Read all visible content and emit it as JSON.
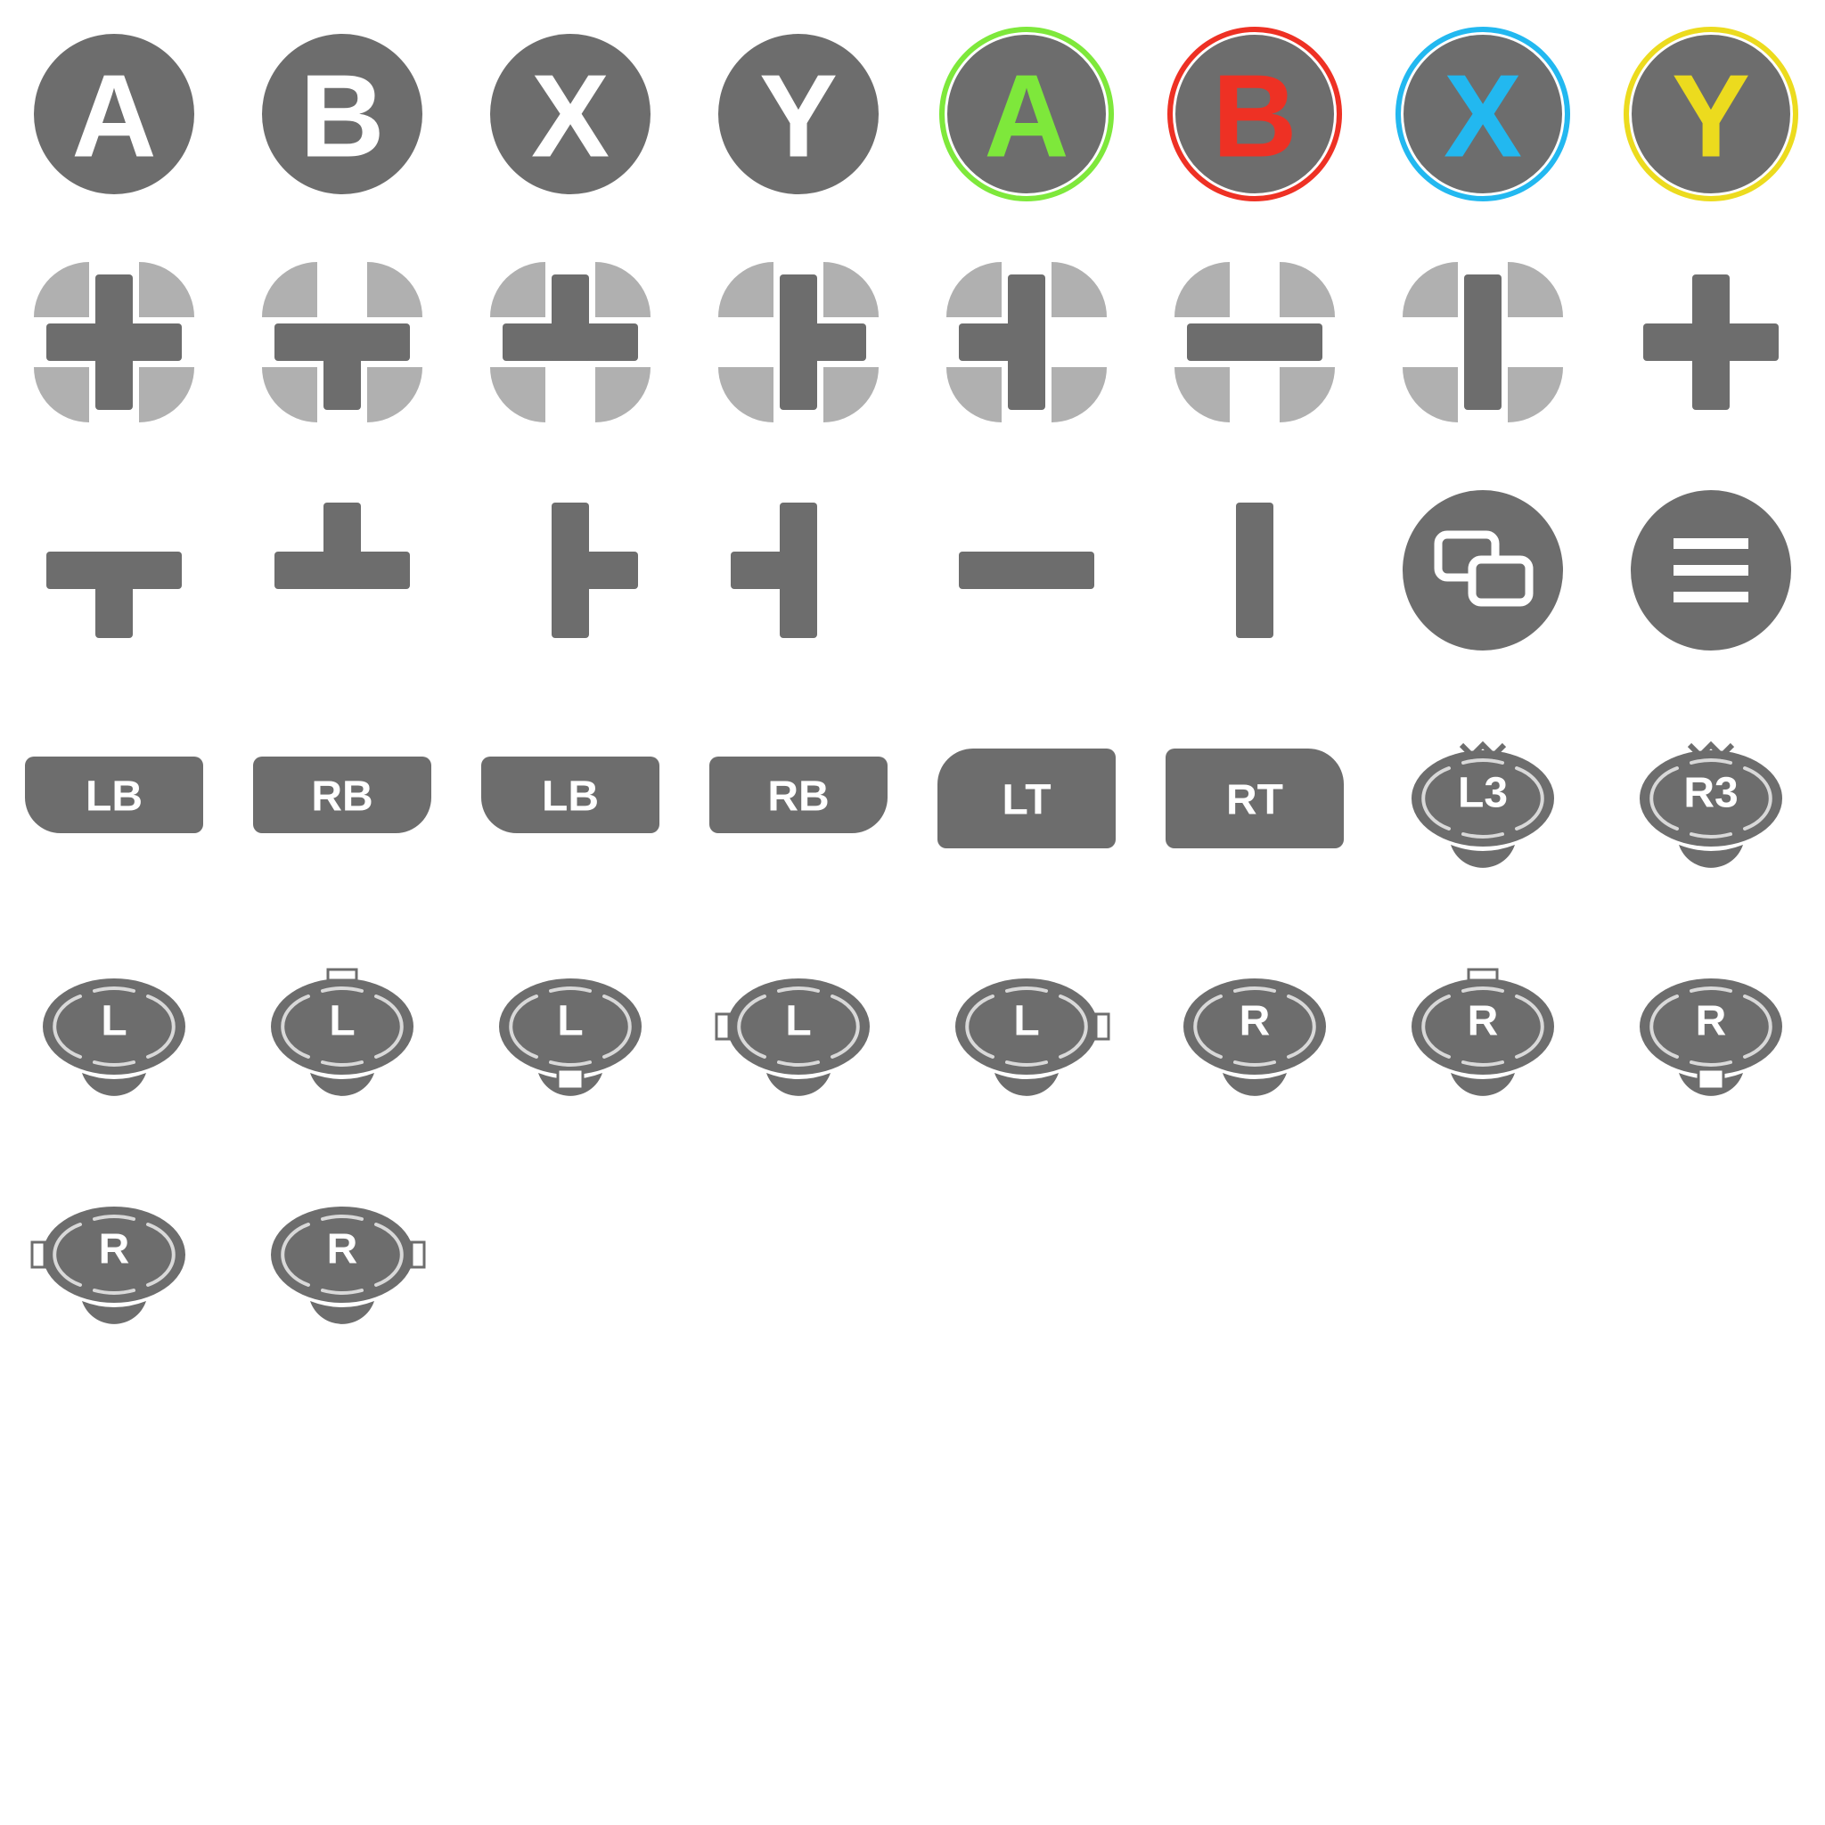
{
  "title": "",
  "colors": {
    "button_fill": "#6d6d6d",
    "glyph_white": "#ffffff",
    "quadrant_fill": "#b0b0b0",
    "ring_light": "#d9d9d9",
    "a_green": "#7ee83b",
    "b_red": "#ee3124",
    "x_blue": "#22b8f0",
    "y_yellow": "#ecdb1e"
  },
  "face_buttons": [
    {
      "name": "button-a",
      "label": "A",
      "style": "plain"
    },
    {
      "name": "button-b",
      "label": "B",
      "style": "plain"
    },
    {
      "name": "button-x",
      "label": "X",
      "style": "plain"
    },
    {
      "name": "button-y",
      "label": "Y",
      "style": "plain"
    },
    {
      "name": "button-a-color",
      "label": "A",
      "style": "colored",
      "color": "#7ee83b"
    },
    {
      "name": "button-b-color",
      "label": "B",
      "style": "colored",
      "color": "#ee3124"
    },
    {
      "name": "button-x-color",
      "label": "X",
      "style": "colored",
      "color": "#22b8f0"
    },
    {
      "name": "button-y-color",
      "label": "Y",
      "style": "colored",
      "color": "#ecdb1e"
    }
  ],
  "dpad_states": [
    "all",
    "left-right-down",
    "left-right-up",
    "up-down-right",
    "up-down-left",
    "left-right",
    "up-down",
    "none"
  ],
  "dpad_shapes": [
    "left-right-down",
    "left-right-up",
    "up-down-right",
    "up-down-left",
    "left-right",
    "up-down"
  ],
  "system_buttons": [
    {
      "name": "view-button",
      "icon": "view-icon"
    },
    {
      "name": "menu-button",
      "icon": "menu-icon"
    }
  ],
  "shoulder_buttons": [
    {
      "name": "bumper-lb-left",
      "label": "LB",
      "kind": "bumper",
      "round": "bottom-left"
    },
    {
      "name": "bumper-rb-left",
      "label": "RB",
      "kind": "bumper",
      "round": "bottom-right"
    },
    {
      "name": "bumper-lb-right",
      "label": "LB",
      "kind": "bumper",
      "round": "bottom-left"
    },
    {
      "name": "bumper-rb-right",
      "label": "RB",
      "kind": "bumper",
      "round": "bottom-right"
    },
    {
      "name": "trigger-lt",
      "label": "LT",
      "kind": "trigger",
      "round": "top-left"
    },
    {
      "name": "trigger-rt",
      "label": "RT",
      "kind": "trigger",
      "round": "top-right"
    }
  ],
  "thumbsticks": [
    {
      "name": "stick-l3",
      "label": "L3",
      "arrow": "press"
    },
    {
      "name": "stick-r3",
      "label": "R3",
      "arrow": "press"
    },
    {
      "name": "stick-l",
      "label": "L",
      "arrow": "none"
    },
    {
      "name": "stick-l-up",
      "label": "L",
      "arrow": "up"
    },
    {
      "name": "stick-l-down",
      "label": "L",
      "arrow": "down"
    },
    {
      "name": "stick-l-left",
      "label": "L",
      "arrow": "left"
    },
    {
      "name": "stick-l-right",
      "label": "L",
      "arrow": "right"
    },
    {
      "name": "stick-r",
      "label": "R",
      "arrow": "none"
    },
    {
      "name": "stick-r-up",
      "label": "R",
      "arrow": "up"
    },
    {
      "name": "stick-r-down",
      "label": "R",
      "arrow": "down"
    },
    {
      "name": "stick-r-left",
      "label": "R",
      "arrow": "left"
    },
    {
      "name": "stick-r-right",
      "label": "R",
      "arrow": "right"
    }
  ]
}
